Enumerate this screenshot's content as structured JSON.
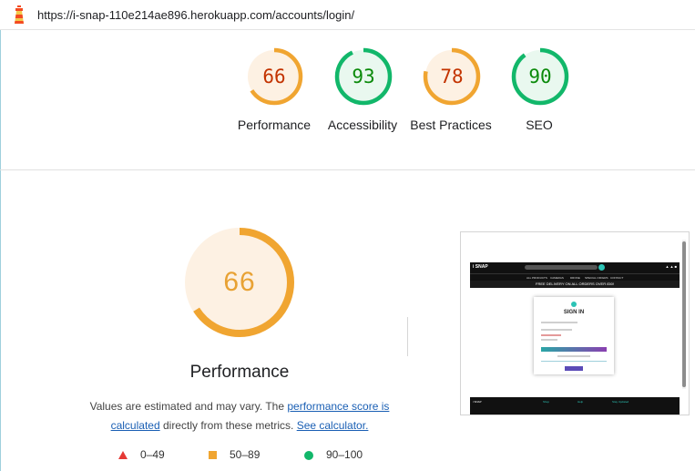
{
  "url": "https://i-snap-110e214ae896.herokuapp.com/accounts/login/",
  "categories": [
    {
      "label": "Performance",
      "score": "66",
      "value": 66,
      "color": "#f0a531",
      "bg": "#fdf1e3",
      "text_color": "#c33300"
    },
    {
      "label": "Accessibility",
      "score": "93",
      "value": 93,
      "color": "#12b76a",
      "bg": "#e9f8ef",
      "text_color": "#0a8a0a"
    },
    {
      "label": "Best Practices",
      "score": "78",
      "value": 78,
      "color": "#f0a531",
      "bg": "#fdf1e3",
      "text_color": "#c33300"
    },
    {
      "label": "SEO",
      "score": "90",
      "value": 90,
      "color": "#12b76a",
      "bg": "#e9f8ef",
      "text_color": "#0a8a0a"
    }
  ],
  "main": {
    "score": "66",
    "value": 66,
    "title": "Performance",
    "desc_prefix": "Values are estimated and may vary. The ",
    "desc_link": "performance score is calculated",
    "desc_middle": " directly from these metrics. ",
    "desc_link2": "See calculator."
  },
  "legend": [
    {
      "shape": "triangle",
      "label": "0–49"
    },
    {
      "shape": "square",
      "label": "50–89"
    },
    {
      "shape": "circle",
      "label": "90–100"
    }
  ],
  "thumbnail": {
    "logo": "i SNAP",
    "menu": [
      "ALL PRODUCTS",
      "CAMERAS",
      "DRONE",
      "SPECIAL OFFERS",
      "CONTACT"
    ],
    "banner": "FREE DELIVERY ON ALL ORDERS OVER £50!",
    "signin": "SIGN IN",
    "footer": [
      "i SNAP",
      "Shop",
      "Help",
      "Stay Updated"
    ]
  },
  "colors": {
    "orange": "#f0a531",
    "green": "#12b76a",
    "red": "#e53935",
    "link": "#1a5fb4"
  }
}
